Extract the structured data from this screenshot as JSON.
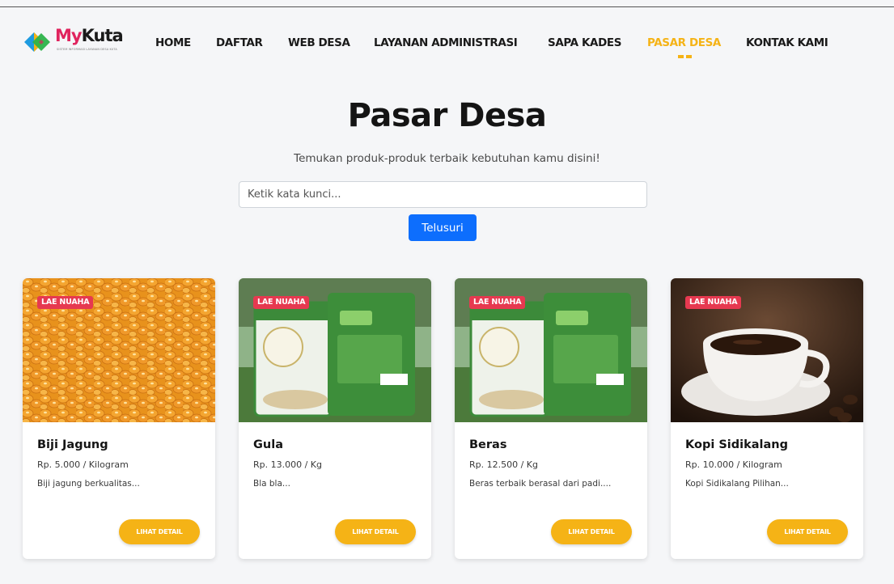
{
  "brand": {
    "logo_my": "My",
    "logo_kuta": "Kuta",
    "logo_subtitle": "SISTEM INFORMASI LAYANAN DESA KUTA",
    "accent_color": "#f5b316",
    "primary_color": "#0d6efd",
    "badge_color": "#e63950"
  },
  "nav": {
    "items": [
      {
        "label": "HOME"
      },
      {
        "label": "DAFTAR"
      },
      {
        "label": "WEB DESA"
      },
      {
        "label": "LAYANAN ADMINISTRASI"
      },
      {
        "label": "SAPA KADES"
      },
      {
        "label": "PASAR DESA",
        "active": true
      },
      {
        "label": "KONTAK KAMI"
      }
    ]
  },
  "hero": {
    "title": "Pasar Desa",
    "subtitle": "Temukan produk-produk terbaik kebutuhan kamu disini!",
    "search_placeholder": "Ketik kata kunci...",
    "search_button": "Telusuri"
  },
  "products": [
    {
      "badge": "LAE NUAHA",
      "name": "Biji Jagung",
      "price": "Rp. 5.000 / Kilogram",
      "desc": "Biji jagung berkualitas...",
      "button": "LIHAT DETAIL",
      "image": "corn-kernels"
    },
    {
      "badge": "LAE NUAHA",
      "name": "Gula",
      "price": "Rp. 13.000 / Kg",
      "desc": "Bla bla...",
      "button": "LIHAT DETAIL",
      "image": "rice-bag-packaging"
    },
    {
      "badge": "LAE NUAHA",
      "name": "Beras",
      "price": "Rp. 12.500 / Kg",
      "desc": "Beras terbaik berasal dari padi....",
      "button": "LIHAT DETAIL",
      "image": "rice-bag-packaging"
    },
    {
      "badge": "LAE NUAHA",
      "name": "Kopi Sidikalang",
      "price": "Rp. 10.000 / Kilogram",
      "desc": "Kopi Sidikalang Pilihan...",
      "button": "LIHAT DETAIL",
      "image": "coffee-cup"
    }
  ]
}
